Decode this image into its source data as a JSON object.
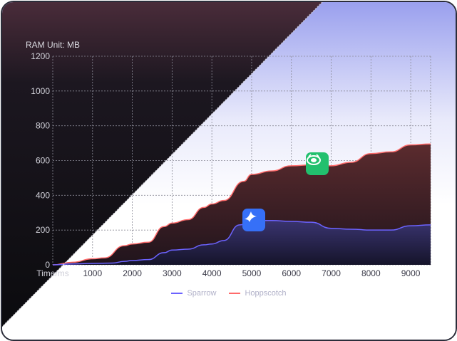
{
  "chart_data": {
    "type": "area",
    "ylabel": "RAM Unit: MB",
    "xlabel": "Time/ms",
    "ylim": [
      0,
      1200
    ],
    "xlim": [
      0,
      9500
    ],
    "yticks": [
      0,
      200,
      400,
      600,
      800,
      1000,
      1200
    ],
    "xticks": [
      1000,
      2000,
      3000,
      4000,
      5000,
      6000,
      7000,
      8000,
      9000
    ],
    "grid": true,
    "legend_position": "bottom-center",
    "series": [
      {
        "name": "Sparrow",
        "color": "#6c63ff",
        "points": [
          [
            0,
            0
          ],
          [
            500,
            5
          ],
          [
            1000,
            8
          ],
          [
            1500,
            10
          ],
          [
            1800,
            20
          ],
          [
            2000,
            25
          ],
          [
            2400,
            30
          ],
          [
            2800,
            70
          ],
          [
            3000,
            85
          ],
          [
            3400,
            90
          ],
          [
            3800,
            115
          ],
          [
            4000,
            120
          ],
          [
            4300,
            140
          ],
          [
            4700,
            230
          ],
          [
            5000,
            255
          ],
          [
            5500,
            255
          ],
          [
            6000,
            250
          ],
          [
            6500,
            245
          ],
          [
            7000,
            210
          ],
          [
            7500,
            205
          ],
          [
            8000,
            200
          ],
          [
            8500,
            200
          ],
          [
            9000,
            225
          ],
          [
            9500,
            230
          ]
        ]
      },
      {
        "name": "Hoppscotch",
        "color": "#ff6b6b",
        "points": [
          [
            0,
            0
          ],
          [
            500,
            15
          ],
          [
            1000,
            35
          ],
          [
            1300,
            40
          ],
          [
            1800,
            110
          ],
          [
            2000,
            120
          ],
          [
            2400,
            130
          ],
          [
            2800,
            220
          ],
          [
            3000,
            240
          ],
          [
            3400,
            260
          ],
          [
            3800,
            330
          ],
          [
            4000,
            350
          ],
          [
            4300,
            370
          ],
          [
            4800,
            480
          ],
          [
            5000,
            520
          ],
          [
            5500,
            540
          ],
          [
            6000,
            570
          ],
          [
            6500,
            575
          ],
          [
            7000,
            570
          ],
          [
            7500,
            590
          ],
          [
            8000,
            640
          ],
          [
            8500,
            650
          ],
          [
            9000,
            690
          ],
          [
            9500,
            695
          ]
        ]
      }
    ]
  },
  "badges": [
    {
      "name": "hoppscotch-logo",
      "color": "#22c06e",
      "icon": "alien-icon"
    },
    {
      "name": "sparrow-logo",
      "color": "#3670f7",
      "icon": "bird-icon"
    }
  ]
}
